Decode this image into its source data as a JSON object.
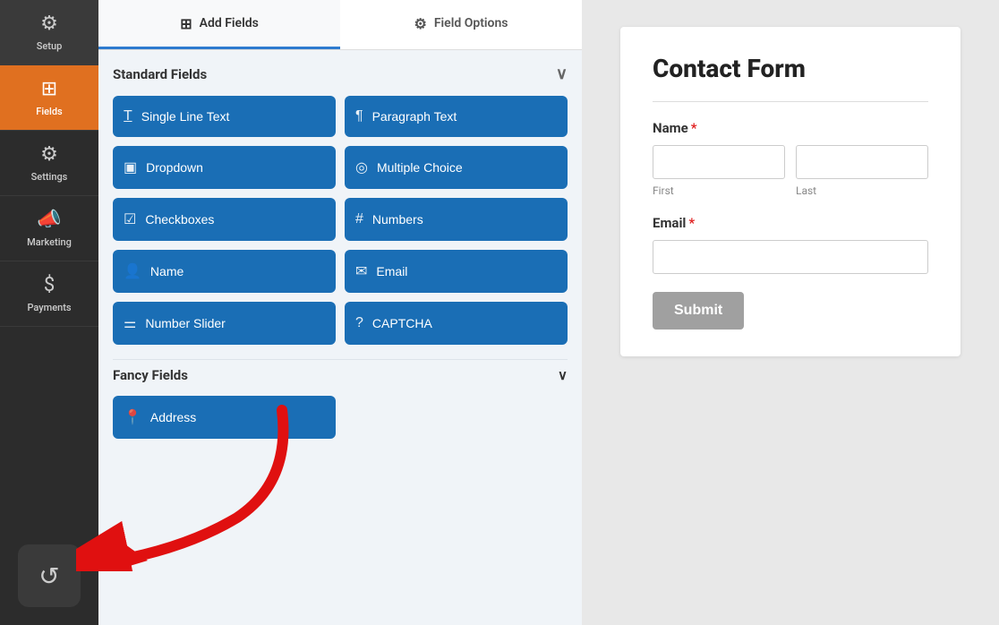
{
  "sidebar": {
    "items": [
      {
        "id": "setup",
        "label": "Setup",
        "icon": "⚙"
      },
      {
        "id": "fields",
        "label": "Fields",
        "icon": "▦",
        "active": true
      },
      {
        "id": "settings",
        "label": "Settings",
        "icon": "⚙"
      },
      {
        "id": "marketing",
        "label": "Marketing",
        "icon": "📢"
      },
      {
        "id": "payments",
        "label": "Payments",
        "icon": "$"
      }
    ],
    "history_icon": "↺"
  },
  "tabs": [
    {
      "id": "add-fields",
      "label": "Add Fields",
      "icon": "▦",
      "active": true
    },
    {
      "id": "field-options",
      "label": "Field Options",
      "icon": "⚙"
    }
  ],
  "standard_fields": {
    "section_label": "Standard Fields",
    "fields": [
      {
        "id": "single-line-text",
        "label": "Single Line Text",
        "icon": "T̲"
      },
      {
        "id": "paragraph-text",
        "label": "Paragraph Text",
        "icon": "¶"
      },
      {
        "id": "dropdown",
        "label": "Dropdown",
        "icon": "▣"
      },
      {
        "id": "multiple-choice",
        "label": "Multiple Choice",
        "icon": "◎"
      },
      {
        "id": "checkboxes",
        "label": "Checkboxes",
        "icon": "☑"
      },
      {
        "id": "numbers",
        "label": "Numbers",
        "icon": "#"
      },
      {
        "id": "name",
        "label": "Name",
        "icon": "👤"
      },
      {
        "id": "email",
        "label": "Email",
        "icon": "✉"
      },
      {
        "id": "number-slider",
        "label": "Number Slider",
        "icon": "⚌"
      },
      {
        "id": "captcha",
        "label": "CAPTCHA",
        "icon": "?"
      }
    ]
  },
  "fancy_fields": {
    "section_label": "Fancy Fields",
    "fields": [
      {
        "id": "address",
        "label": "Address",
        "icon": "📍"
      }
    ]
  },
  "form_preview": {
    "title": "Contact Form",
    "name_label": "Name",
    "name_required": true,
    "first_placeholder": "First",
    "last_placeholder": "Last",
    "email_label": "Email",
    "email_required": true,
    "submit_label": "Submit"
  }
}
